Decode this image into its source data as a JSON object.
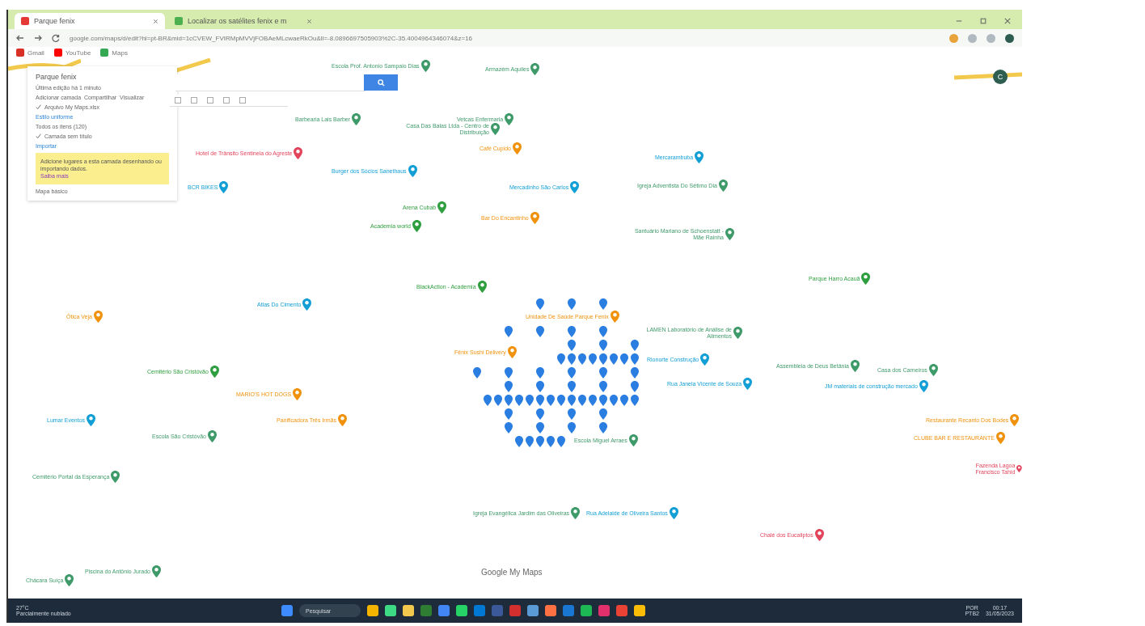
{
  "browser": {
    "tabs": [
      {
        "title": "Parque fenix",
        "selected": true
      },
      {
        "title": "Localizar os satélites fenix e m",
        "selected": false
      }
    ],
    "address": "google.com/maps/d/edit?hl=pt-BR&mid=1cCVEW_FVIRMpMVVjFOBAeMLcwaeRkOu&ll=-8.0896697505903%2C-35.4004964346074&z=16",
    "bookmarks": [
      "Gmail",
      "YouTube",
      "Maps"
    ]
  },
  "panel": {
    "title": "Parque fenix",
    "subtitle": "Última edição há 1 minuto",
    "actions": [
      "Adicionar camada",
      "Compartilhar",
      "Visualizar"
    ],
    "layers": [
      {
        "name": "Arquivo My Maps.xlsx",
        "checked": true,
        "style": "Estilo uniforme",
        "items": "Todos os itens (120)"
      },
      {
        "name": "Camada sem título",
        "checked": true,
        "import": "Importar",
        "note": "Adicione lugares a esta camada desenhando ou importando dados.",
        "link": "Saiba mais"
      }
    ],
    "basemap": "Mapa básico"
  },
  "places": [
    {
      "name": "Escola Prof. Antonio Sampaio Dias",
      "color": "#3f9a6a"
    },
    {
      "name": "Armazém Aquiles",
      "color": "#3f9a6a"
    },
    {
      "name": "Barbearia Lais Barber",
      "color": "#3f9a6a"
    },
    {
      "name": "Vetcas Enfermaria",
      "color": "#3f9a6a"
    },
    {
      "name": "Casa Das Balas Ltda - Centro de Distribuição",
      "color": "#3f9a6a"
    },
    {
      "name": "Hotel de Trânsito Sentinela do Agreste",
      "color": "#e2445c"
    },
    {
      "name": "Café Cupido",
      "color": "#f0920d"
    },
    {
      "name": "BCR BIKES",
      "color": "#129fd6"
    },
    {
      "name": "Burger dos Sócios Sanethaus",
      "color": "#129fd6"
    },
    {
      "name": "Mercadinho São Carlos",
      "color": "#129fd6"
    },
    {
      "name": "Mercarambuba",
      "color": "#129fd6"
    },
    {
      "name": "Igreja Adventista Do Sétimo Dia",
      "color": "#3f9a6a"
    },
    {
      "name": "Arena Cubab",
      "color": "#2e9e3e"
    },
    {
      "name": "Bar Do Encantinho",
      "color": "#f0920d"
    },
    {
      "name": "Academia world",
      "color": "#2e9e3e"
    },
    {
      "name": "Santuário Mariano de Schoenstatt - Mãe Rainha",
      "color": "#3f9a6a"
    },
    {
      "name": "BlackAction - Academia",
      "color": "#2e9e3e"
    },
    {
      "name": "Parque Harro Acauã",
      "color": "#2e9e3e"
    },
    {
      "name": "Atlas Do Cimento",
      "color": "#129fd6"
    },
    {
      "name": "Ótica Veja",
      "color": "#f0920d"
    },
    {
      "name": "Unidade De Saúde Parque Fenix",
      "color": "#f0920d"
    },
    {
      "name": "Fênix Sushi Delivery",
      "color": "#f0920d"
    },
    {
      "name": "LAMEN Laboratório de Análise de Alimentos",
      "color": "#3f9a6a"
    },
    {
      "name": "Rionorte Construção",
      "color": "#129fd6"
    },
    {
      "name": "Rua Janela Vicente de Souza",
      "color": "#129fd6"
    },
    {
      "name": "Escola Miguel Arraes",
      "color": "#3f9a6a"
    },
    {
      "name": "Assembleia de Deus Betânia",
      "color": "#3f9a6a"
    },
    {
      "name": "Casa dos Carneiros",
      "color": "#3f9a6a"
    },
    {
      "name": "JM materiais de construção mercado",
      "color": "#129fd6"
    },
    {
      "name": "Restaurante Recanto Dos Bodes",
      "color": "#f0920d"
    },
    {
      "name": "CLUBE BAR E RESTAURANTE",
      "color": "#f0920d"
    },
    {
      "name": "Fazenda Lagoa Francisco Tahid",
      "color": "#e2445c"
    },
    {
      "name": "Chalé dos Eucaliptos",
      "color": "#e2445c"
    },
    {
      "name": "Igreja Evangélica Jardim das Oliveiras",
      "color": "#3f9a6a"
    },
    {
      "name": "Rua Adelaide de Oliveira Santos",
      "color": "#129fd6"
    },
    {
      "name": "Cemitério São Cristóvão",
      "color": "#2e9e3e"
    },
    {
      "name": "MARIO'S HOT DOGS",
      "color": "#f0920d"
    },
    {
      "name": "Panificadora Três Irmãs",
      "color": "#f0920d"
    },
    {
      "name": "Escola São Cristóvão",
      "color": "#3f9a6a"
    },
    {
      "name": "Lumar Eventos",
      "color": "#129fd6"
    },
    {
      "name": "Cemitério Portal da Esperança",
      "color": "#3f9a6a"
    },
    {
      "name": "Piscina do Antônio Jurado",
      "color": "#3f9a6a"
    },
    {
      "name": "Chácara Suíça",
      "color": "#3f9a6a"
    }
  ],
  "map_logo": "Google My Maps",
  "map_avatar": "C",
  "taskbar": {
    "temperature": "27°C",
    "weather": "Parcialmente nublado",
    "search": "Pesquisar",
    "lang": "POR",
    "layout": "PTB2",
    "time": "00:17",
    "date": "31/05/2023"
  }
}
